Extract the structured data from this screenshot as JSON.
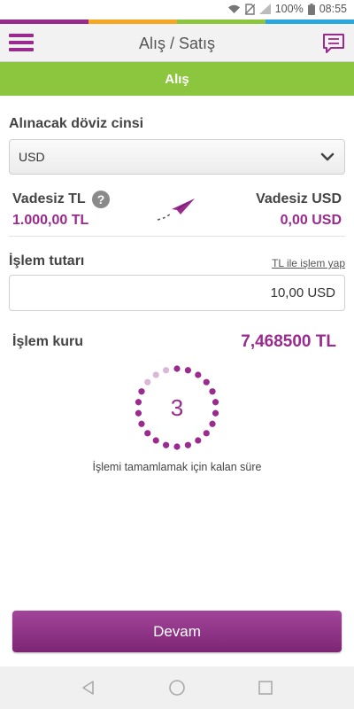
{
  "status_bar": {
    "battery": "100%",
    "time": "08:55"
  },
  "colors": {
    "brand_purple": "#9b2a8f",
    "tab_green": "#8cc63f",
    "stripe": [
      "#9b2a8f",
      "#f5a623",
      "#8cc63f",
      "#2aa7df"
    ],
    "button_purple": "#8e2f86"
  },
  "header": {
    "title": "Alış / Satış",
    "menu_icon": "hamburger-menu-icon",
    "chat_icon": "chat-bubble-icon"
  },
  "tab": {
    "label": "Alış"
  },
  "currency": {
    "label": "Alınacak döviz cinsi",
    "selected": "USD"
  },
  "accounts": {
    "from": {
      "name": "Vadesiz TL",
      "balance": "1.000,00 TL"
    },
    "to": {
      "name": "Vadesiz USD",
      "balance": "0,00 USD"
    },
    "help_glyph": "?"
  },
  "amount": {
    "label": "İşlem tutarı",
    "link": "TL ile işlem yap",
    "value": "10,00 USD"
  },
  "rate": {
    "label": "İşlem kuru",
    "value": "7,468500 TL"
  },
  "timer": {
    "seconds": "3",
    "caption": "İşlemi tamamlamak için kalan süre"
  },
  "primary_button": {
    "label": "Devam"
  },
  "nav_bar": {
    "back": "back-triangle-icon",
    "home": "home-circle-icon",
    "recents": "recents-square-icon"
  }
}
